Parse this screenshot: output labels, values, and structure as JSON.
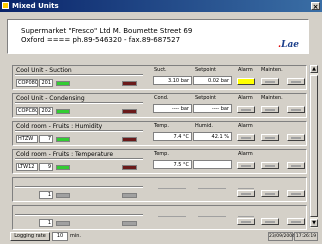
{
  "window": {
    "title": "Mixed Units",
    "close_label": "×"
  },
  "header": {
    "line1": "Supermarket \"Fresco\" Ltd  M. Boumette Street 69",
    "line2": "Oxford   ====   ph.89-546320 - fax.89-687527",
    "logo_main": "Lae",
    "logo_dot": "."
  },
  "panels": [
    {
      "name": "Cool Unit - Suction",
      "controller": "COP080",
      "address": "201",
      "m1_label": "Suct.",
      "m1_value": "3.10 bar",
      "m2_label": "Setpoint",
      "m2_value": "0.02 bar",
      "alarm_label": "Alarm",
      "maint_label": "Mainten."
    },
    {
      "name": "Cool Unit - Condensing",
      "controller": "COPC80",
      "address": "202",
      "m1_label": "Cond.",
      "m1_value": "---- bar",
      "m2_label": "Setpoint",
      "m2_value": "---- bar",
      "alarm_label": "Alarm",
      "maint_label": "Mainten."
    },
    {
      "name": "Cold room - Fruits : Humidity",
      "controller": "HTZW",
      "address": "7",
      "m1_label": "Temp.",
      "m1_value": "7.4 °C",
      "m2_label": "Humid.",
      "m2_value": "42.1 %",
      "alarm_label": "Alarm",
      "maint_label": ""
    },
    {
      "name": "Cold room - Fruits : Temperature",
      "controller": "LTW12",
      "address": "9",
      "m1_label": "Temp.",
      "m1_value": "7.5 °C",
      "m2_label": "Setpoint",
      "m2_value": "",
      "alarm_label": "Alarm",
      "maint_label": ""
    },
    {
      "name": "",
      "controller": "",
      "address": "1",
      "m1_label": "",
      "m1_value": "",
      "m2_label": "",
      "m2_value": "",
      "alarm_label": "",
      "maint_label": ""
    },
    {
      "name": "",
      "controller": "",
      "address": "1",
      "m1_label": "",
      "m1_value": "",
      "m2_label": "",
      "m2_value": "",
      "alarm_label": "",
      "maint_label": ""
    }
  ],
  "footer": {
    "logging_label": "Logging rate",
    "logging_value": "10",
    "logging_unit": "min.",
    "date": "23/09/2004",
    "time": "17:26:19"
  },
  "colors": {
    "led_green": "#33cc33",
    "alarm_yellow": "#ffff00",
    "led_red": "#6a1a1a",
    "logo_blue": "#1a3e8a"
  }
}
